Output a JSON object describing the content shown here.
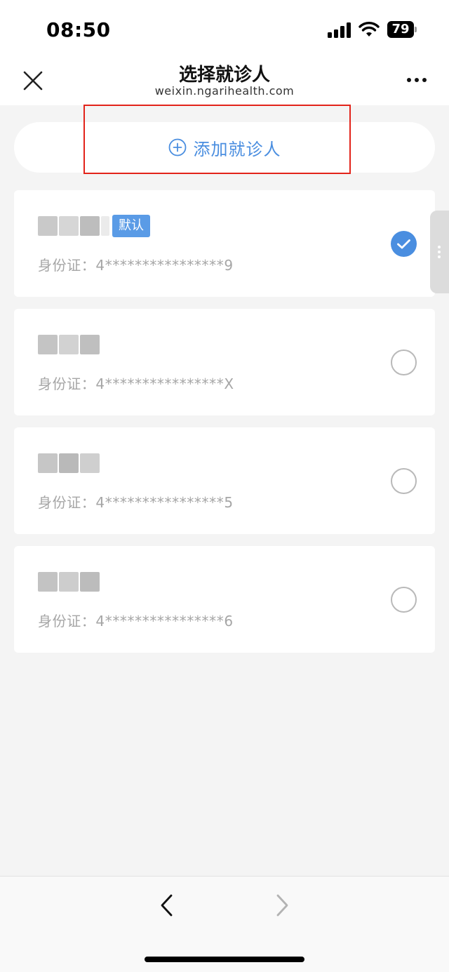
{
  "status_bar": {
    "time": "08:50",
    "battery": "79"
  },
  "nav": {
    "title": "选择就诊人",
    "subtitle": "weixin.ngarihealth.com",
    "close_icon": "close-icon",
    "more_icon": "more-dots-icon"
  },
  "add_patient": {
    "label": "添加就诊人",
    "icon": "plus-circle-icon"
  },
  "patients": [
    {
      "name_redacted": true,
      "badge": "默认",
      "id_label": "身份证：",
      "id_value": "4****************9",
      "selected": true
    },
    {
      "name_redacted": true,
      "badge": "",
      "id_label": "身份证：",
      "id_value": "4****************X",
      "selected": false
    },
    {
      "name_redacted": true,
      "badge": "",
      "id_label": "身份证：",
      "id_value": "4****************5",
      "selected": false
    },
    {
      "name_redacted": true,
      "badge": "",
      "id_label": "身份证：",
      "id_value": "4****************6",
      "selected": false
    }
  ],
  "colors": {
    "accent": "#4a8ee0",
    "badge": "#5a9be6",
    "highlight": "#e2231a",
    "id_text": "#a6a6a6",
    "background": "#f4f4f4"
  },
  "bottom_nav": {
    "back_icon": "chevron-left-icon",
    "forward_icon": "chevron-right-icon"
  }
}
